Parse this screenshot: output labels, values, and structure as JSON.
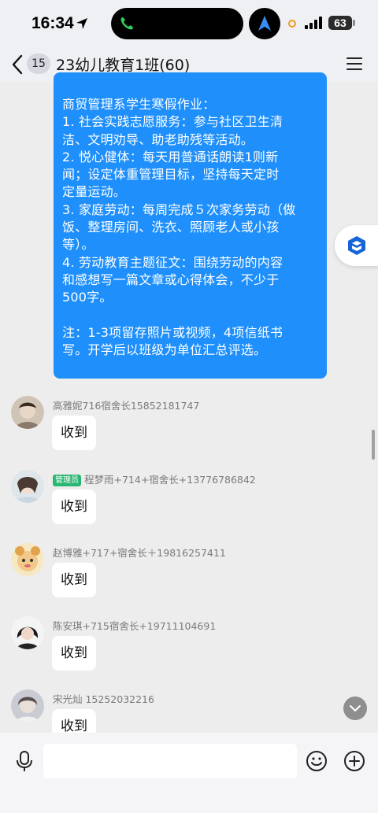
{
  "status_bar": {
    "time": "16:34",
    "battery": "63"
  },
  "header": {
    "unread_count": "15",
    "title": "23幼儿教育1班(60)"
  },
  "announcement": {
    "lines": [
      "商贸管理系学生寒假作业：",
      "1. 社会实践志愿服务：参与社区卫生清",
      "洁、文明劝导、助老助残等活动。",
      "2. 悦心健体：每天用普通话朗读1则新",
      "闻；设定体重管理目标，坚持每天定时",
      "定量运动。",
      "3. 家庭劳动：每周完成５次家务劳动（做",
      "饭、整理房间、洗衣、照顾老人或小孩",
      "等）。",
      "4. 劳动教育主题征文：围绕劳动的内容",
      "和感想写一篇文章或心得体会，不少于",
      "500字。",
      "",
      "注：1-3项留存照片或视频，4项信纸书",
      "写。开学后以班级为单位汇总评选。"
    ]
  },
  "messages": [
    {
      "sender": "高雅妮716宿舍长15852181747",
      "text": "收到"
    },
    {
      "admin_tag": "管理员",
      "sender": "程梦雨+714+宿舍长+13776786842",
      "text": "收到"
    },
    {
      "sender": "赵博雅+717+宿舍长＋19816257411",
      "text": "收到"
    },
    {
      "sender": "陈安琪+715宿舍长+19711104691",
      "text": "收到"
    },
    {
      "sender": "宋光灿  15252032216",
      "text": "收到"
    }
  ],
  "colors": {
    "bubble": "#1e8ffb",
    "admin_tag": "#2bb673"
  },
  "icons": [
    "back-icon",
    "menu-icon",
    "mic-icon",
    "emoji-icon",
    "plus-icon",
    "chevron-down-icon",
    "phone-icon",
    "navigation-icon",
    "signal-icon"
  ]
}
